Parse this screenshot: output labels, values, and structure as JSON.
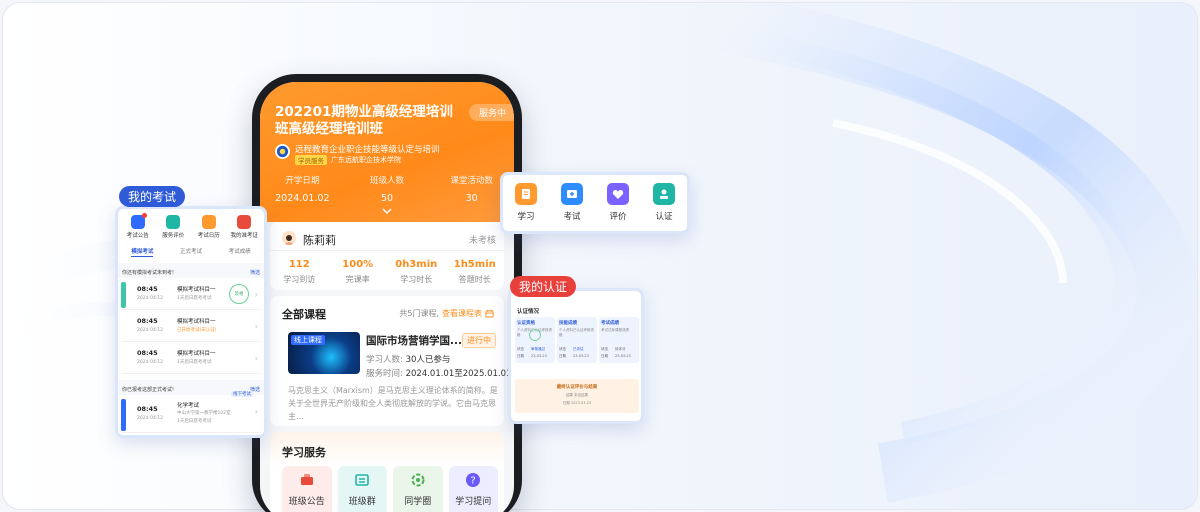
{
  "hero": {
    "title": "202201期物业高级经理培训班高级经理培训班",
    "badge": "服务中",
    "org_name": "远程教育企业职企技能等级认定与培训",
    "org_tag": "学员服务",
    "org_school": "广东远航职企技术学院",
    "stats": [
      {
        "label": "开学日期",
        "value": "2024.01.02"
      },
      {
        "label": "班级人数",
        "value": "50"
      },
      {
        "label": "课堂活动数",
        "value": "30"
      }
    ]
  },
  "profile": {
    "name": "陈莉莉",
    "status": "未考核",
    "stats": [
      {
        "value": "112",
        "label": "学习到访"
      },
      {
        "value": "100%",
        "label": "完课率"
      },
      {
        "value": "0h3min",
        "label": "学习时长"
      },
      {
        "value": "1h5min",
        "label": "答题时长"
      }
    ]
  },
  "courses": {
    "title": "全部课程",
    "count_note": "共5门课程,",
    "link": "查看课程表",
    "item": {
      "thumb_label": "线上课程",
      "name": "国际市场营销学国...",
      "status": "进行中",
      "learners_label": "学习人数:",
      "learners": "30人已参与",
      "period_label": "服务时间:",
      "period": "2024.01.01至2025.01.01",
      "desc": "马克思主义（Marxism）是马克思主义理论体系的简称。是关于全世界无产阶级和全人类彻底解放的学说。它由马克思主..."
    }
  },
  "services": {
    "title": "学习服务",
    "items": [
      {
        "label": "班级公告",
        "icon": "megaphone-icon",
        "color": "#e84b3c",
        "bg": "#fdecea"
      },
      {
        "label": "班级群",
        "icon": "group-icon",
        "color": "#1fb6a6",
        "bg": "#e4f7f4"
      },
      {
        "label": "同学圈",
        "icon": "circle-icon",
        "color": "#4caf50",
        "bg": "#eaf6ea"
      },
      {
        "label": "学习提问",
        "icon": "question-icon",
        "color": "#6a5af9",
        "bg": "#eeecff"
      }
    ]
  },
  "exam": {
    "pill": "我的考试",
    "icons": [
      {
        "label": "考试公告",
        "color": "#2f6bff"
      },
      {
        "label": "服务评价",
        "color": "#1fb6a6"
      },
      {
        "label": "考试日历",
        "color": "#ff9a2e"
      },
      {
        "label": "我的准考证",
        "color": "#e84b3c"
      }
    ],
    "tabs": [
      "模拟考试",
      "正式考试",
      "考试成绩"
    ],
    "section1": "你还有模拟考试未到考!",
    "filter": "筛选",
    "rows": [
      {
        "time": "08:45",
        "date": "2024-04-12",
        "name": "模拟考试科目一",
        "desc": "1天后日底考考试",
        "bar": "#3ec6a5",
        "stamp": "及格"
      },
      {
        "time": "08:45",
        "date": "2024-04-12",
        "name": "模拟考试科目一",
        "desc": "已开始考试(未认证)",
        "bar": "#ffffff",
        "stamp": ""
      },
      {
        "time": "08:45",
        "date": "2024-04-12",
        "name": "模拟考试科目一",
        "desc": "1天后日底考考试",
        "bar": "#ffffff",
        "stamp": ""
      }
    ],
    "section2": "你已报考这部正式考试!",
    "formal": {
      "time": "08:45",
      "date": "2024-04-12",
      "name": "化学考试",
      "location": "中山大学第一教学楼102室",
      "desc": "1天后日底考考试",
      "action": "线下考试"
    }
  },
  "quick": {
    "items": [
      {
        "label": "学习",
        "icon": "book-icon",
        "color": "#ff9a2e"
      },
      {
        "label": "考试",
        "icon": "exam-icon",
        "color": "#2f8cff"
      },
      {
        "label": "评价",
        "icon": "heart-icon",
        "color": "#7b61ff"
      },
      {
        "label": "认证",
        "icon": "certificate-icon",
        "color": "#1fb6a6"
      }
    ]
  },
  "cert": {
    "pill": "我的认证",
    "title": "认证情况",
    "boxes": [
      {
        "title": "认证资格",
        "sub": "个人资料已认证考核资格",
        "k1": "状态",
        "v1": "审核通过",
        "k2": "日期",
        "v2": "23-03-23"
      },
      {
        "title": "技能成绩",
        "sub": "个人资料已认证考核资格",
        "k1": "状态",
        "v1": "已评估",
        "k2": "日期",
        "v2": "23-03-23"
      },
      {
        "title": "考试成绩",
        "sub": "考试达标课程成绩",
        "k1": "状态",
        "v1": "待评分",
        "k2": "日期",
        "v2": "23-03-23"
      }
    ],
    "footer": {
      "title": "最终认证评价与结果",
      "k1": "结果",
      "v1": "未出结果",
      "k2": "日期",
      "v2": "2023-03-23"
    }
  }
}
